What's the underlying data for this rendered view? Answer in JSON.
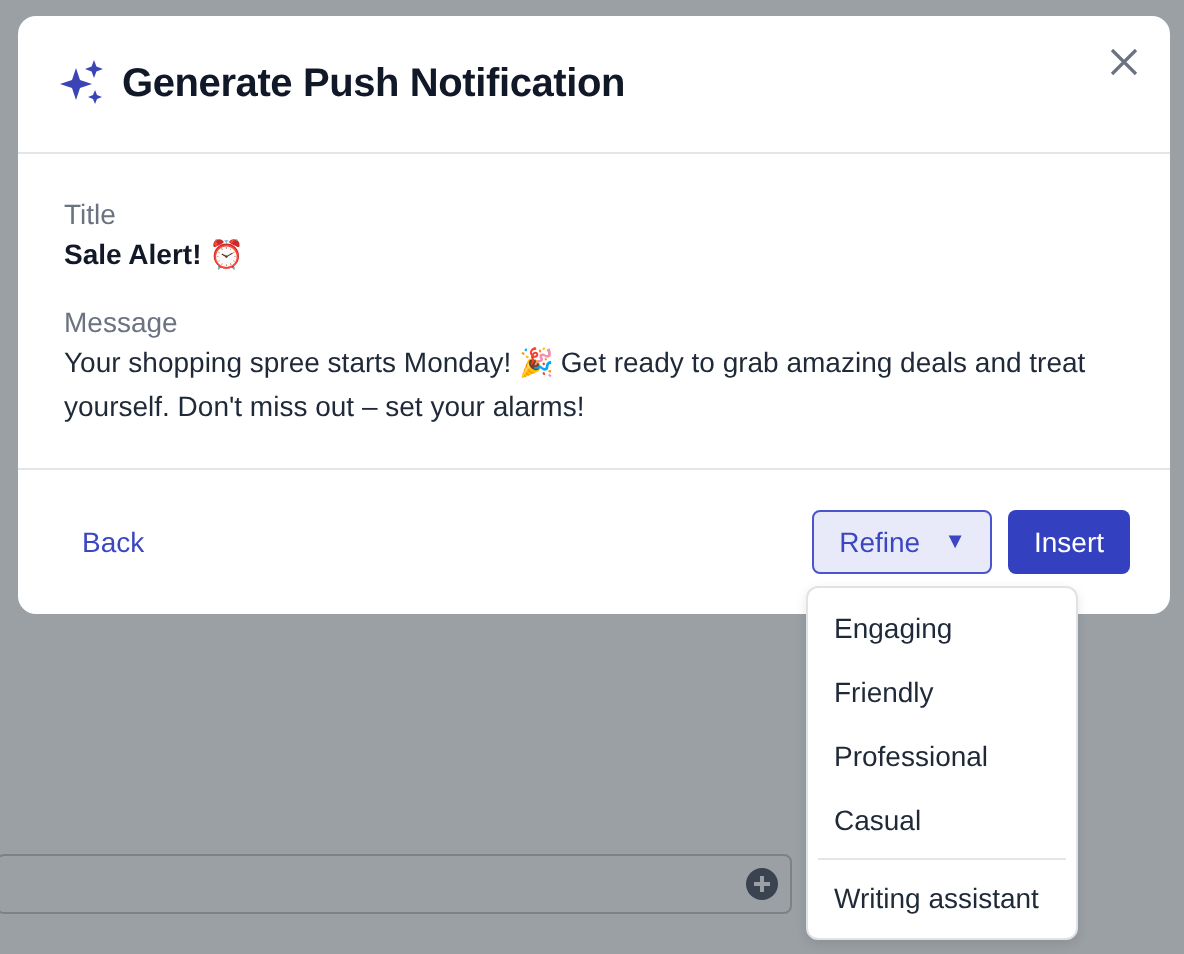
{
  "dialog": {
    "title": "Generate Push Notification",
    "fields": [
      {
        "label": "Title",
        "value": "Sale Alert! ⏰",
        "kind": "title"
      },
      {
        "label": "Message",
        "value": "Your shopping spree starts Monday! 🎉 Get ready to grab amazing deals and treat yourself. Don't miss out – set your alarms!",
        "kind": "body"
      }
    ],
    "back": "Back",
    "refine": {
      "label": "Refine",
      "caret": "▼",
      "expanded": true
    },
    "insert": "Insert"
  },
  "refine_menu": {
    "groups": [
      {
        "items": [
          "Engaging",
          "Friendly",
          "Professional",
          "Casual"
        ]
      },
      {
        "items": [
          "Writing assistant"
        ]
      }
    ]
  }
}
